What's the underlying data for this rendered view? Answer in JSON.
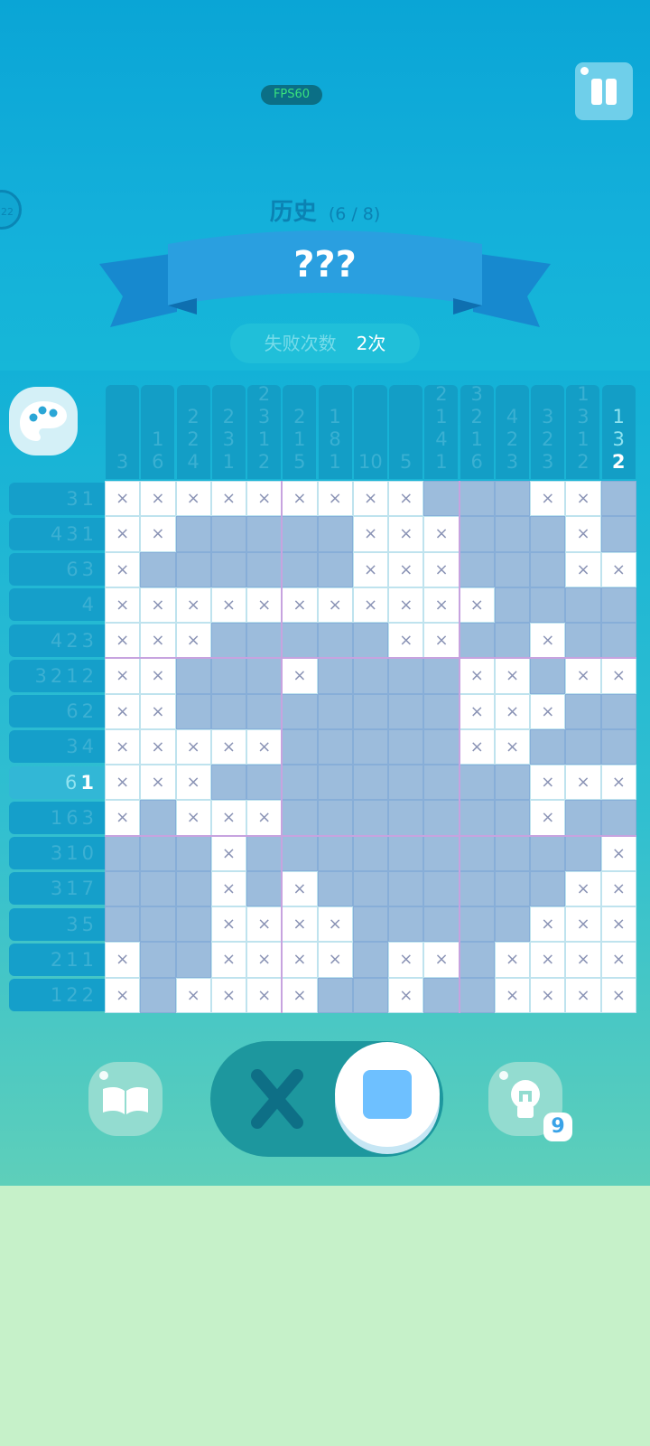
{
  "header": {
    "fps_label": "FPS60",
    "side_badge": "22",
    "category": "历史",
    "progress": "(6 / 8)",
    "puzzle_title": "???",
    "fail_label": "失败次数",
    "fail_value": "2次"
  },
  "icons": {
    "pause": "pause-icon",
    "palette": "palette-icon",
    "book": "book-icon",
    "hint": "lightbulb-icon",
    "cross": "cross-mode-icon",
    "fill": "fill-mode-icon"
  },
  "colors": {
    "sky": "#0aa5d6",
    "ribbon": "#1e93d6",
    "filled_cell": "#9cbcdc",
    "clue_bg": "#159fca",
    "bottom_bg": "#c6f1c9"
  },
  "column_clues": [
    "3",
    "1\n6",
    "2\n2\n4",
    "2\n3\n1",
    "2\n3\n1\n2",
    "2\n1\n5",
    "1\n8\n1",
    "10",
    "5",
    "2\n1\n4\n1",
    "3\n2\n1\n6",
    "4\n2\n3",
    "3\n2\n3",
    "1\n3\n1\n2",
    "1\n3\n2"
  ],
  "row_clues": [
    {
      "text": "3 1",
      "active": false
    },
    {
      "text": "4 3 1",
      "active": false
    },
    {
      "text": "6 3",
      "active": false
    },
    {
      "text": "4",
      "active": false
    },
    {
      "text": "4 2 3",
      "active": false
    },
    {
      "text": "3 2 1 2",
      "active": false
    },
    {
      "text": "6 2",
      "active": false
    },
    {
      "text": "3 4",
      "active": false
    },
    {
      "text": "6 1",
      "active": true
    },
    {
      "text": "1 6 3",
      "active": false
    },
    {
      "text": "3 10",
      "active": false
    },
    {
      "text": "3 1 7",
      "active": false
    },
    {
      "text": "3 5",
      "active": false
    },
    {
      "text": "2 1 1",
      "active": false
    },
    {
      "text": "1 2 2",
      "active": false
    }
  ],
  "grid_rows": [
    "XXXXXXXXX...XX.",
    "XX.....XXX...X.X",
    "X......XXX...XX",
    "XXXXXXXXXXX....",
    "XXX.....XX..X..",
    "XX...X....XX.XX..",
    "XX........XXX..XX",
    "XXXXX.....XX....X",
    "XXX.........XXXXX ",
    "X.XXX.......X...",
    "...X..........X",
    "...X.X.......XX",
    "...XXXX.....XXX",
    "X..XXXX.XX.XXXX",
    "X.XXXX..X..XXXX"
  ],
  "controls": {
    "hint_count": "9"
  }
}
